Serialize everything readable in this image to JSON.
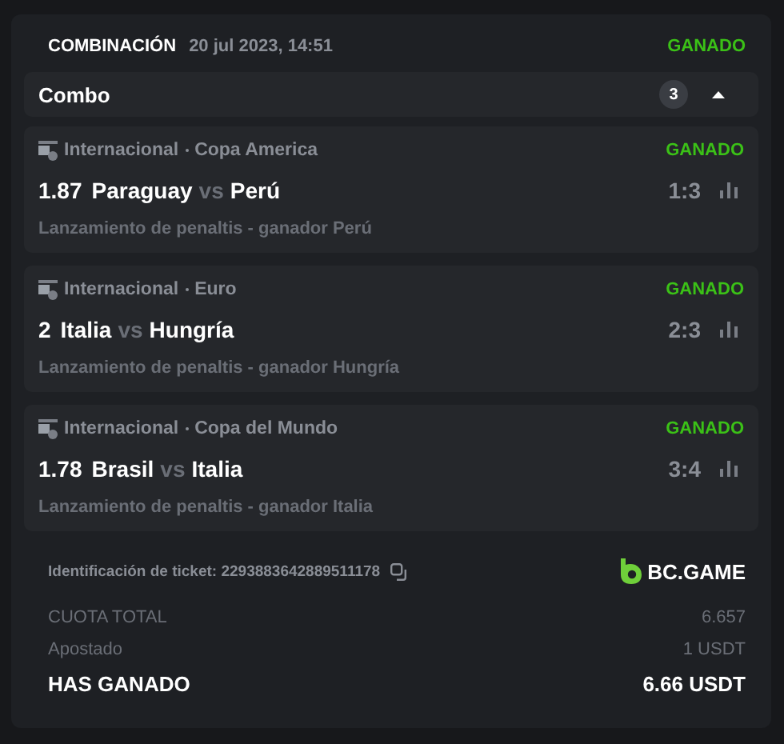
{
  "header": {
    "type": "COMBINACIÓN",
    "date": "20 jul 2023, 14:51",
    "status": "GANADO",
    "kind": "won"
  },
  "combo": {
    "title": "Combo",
    "count": "3",
    "expanded": true
  },
  "bets": [
    {
      "category": "Internacional",
      "league": "Copa America",
      "status": "GANADO",
      "kind": "won",
      "odds": "1.87",
      "home": "Paraguay",
      "vs": "vs",
      "away": "Perú",
      "score": "1:3",
      "market": "Lanzamiento de penaltis - ganador Perú"
    },
    {
      "category": "Internacional",
      "league": "Euro",
      "status": "GANADO",
      "kind": "won",
      "odds": "2",
      "home": "Italia",
      "vs": "vs",
      "away": "Hungría",
      "score": "2:3",
      "market": "Lanzamiento de penaltis - ganador Hungría"
    },
    {
      "category": "Internacional",
      "league": "Copa del Mundo",
      "status": "GANADO",
      "kind": "won",
      "odds": "1.78",
      "home": "Brasil",
      "vs": "vs",
      "away": "Italia",
      "score": "3:4",
      "market": "Lanzamiento de penaltis - ganador Italia"
    }
  ],
  "ticket": {
    "label": "Identificación de ticket:",
    "id": "2293883642889511178"
  },
  "brand": "BC.GAME",
  "totals": [
    {
      "label": "CUOTA TOTAL",
      "value": "6.657",
      "kind": "muted"
    },
    {
      "label": "Apostado",
      "value": "1 USDT",
      "kind": "muted"
    },
    {
      "label": "HAS GANADO",
      "value": "6.66 USDT",
      "kind": "strong"
    }
  ]
}
